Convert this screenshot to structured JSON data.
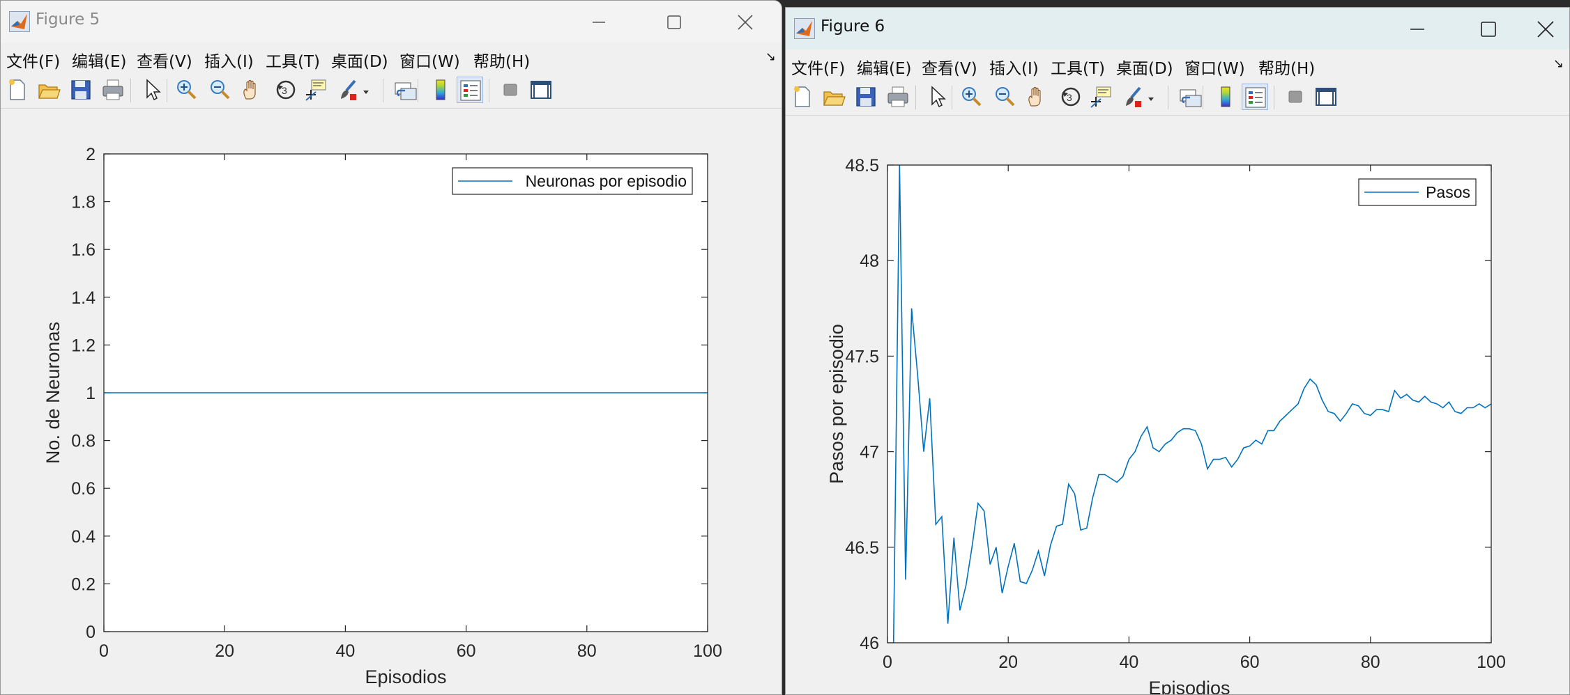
{
  "menu_labels": [
    "文件(F)",
    "编辑(E)",
    "查看(V)",
    "插入(I)",
    "工具(T)",
    "桌面(D)",
    "窗口(W)",
    "帮助(H)"
  ],
  "toolbar_buttons": [
    {
      "name": "new-figure-icon"
    },
    {
      "name": "open-file-icon"
    },
    {
      "name": "save-icon"
    },
    {
      "name": "print-icon"
    },
    {
      "name": "edit-plot-arrow-icon"
    },
    {
      "name": "zoom-in-icon"
    },
    {
      "name": "zoom-out-icon"
    },
    {
      "name": "pan-hand-icon"
    },
    {
      "name": "rotate-3d-icon"
    },
    {
      "name": "data-cursor-icon"
    },
    {
      "name": "brush-icon"
    },
    {
      "name": "link-plot-icon"
    },
    {
      "name": "colorbar-icon"
    },
    {
      "name": "legend-icon"
    },
    {
      "name": "hide-plot-tools-icon"
    },
    {
      "name": "show-plot-tools-icon"
    }
  ],
  "windows": [
    {
      "id": "win5",
      "title": "Figure 5",
      "chart_data": {
        "type": "line",
        "xlabel": "Episodios",
        "ylabel": "No. de Neuronas",
        "xlim": [
          0,
          100
        ],
        "ylim": [
          0,
          2
        ],
        "xticks": [
          "0",
          "20",
          "40",
          "60",
          "80",
          "100"
        ],
        "yticks": [
          "0",
          "0.2",
          "0.4",
          "0.6",
          "0.8",
          "1",
          "1.2",
          "1.4",
          "1.6",
          "1.8",
          "2"
        ],
        "legend_position": "top-right",
        "series": [
          {
            "name": "Neuronas por episodio",
            "color": "#0072bd",
            "x": [
              0,
              100
            ],
            "y": [
              1,
              1
            ]
          }
        ]
      }
    },
    {
      "id": "win6",
      "title": "Figure 6",
      "chart_data": {
        "type": "line",
        "xlabel": "Episodios",
        "ylabel": "Pasos por episodio",
        "xlim": [
          0,
          100
        ],
        "ylim": [
          46,
          48.5
        ],
        "xticks": [
          "0",
          "20",
          "40",
          "60",
          "80",
          "100"
        ],
        "yticks": [
          "46",
          "46.5",
          "47",
          "47.5",
          "48",
          "48.5"
        ],
        "legend_position": "top-right",
        "series": [
          {
            "name": "Pasos",
            "color": "#0072bd",
            "x": [
              1,
              2,
              3,
              4,
              5,
              6,
              7,
              8,
              9,
              10,
              11,
              12,
              13,
              14,
              15,
              16,
              17,
              18,
              19,
              20,
              21,
              22,
              23,
              24,
              25,
              26,
              27,
              28,
              29,
              30,
              31,
              32,
              33,
              34,
              35,
              36,
              37,
              38,
              39,
              40,
              41,
              42,
              43,
              44,
              45,
              46,
              47,
              48,
              49,
              50,
              51,
              52,
              53,
              54,
              55,
              56,
              57,
              58,
              59,
              60,
              61,
              62,
              63,
              64,
              65,
              66,
              67,
              68,
              69,
              70,
              71,
              72,
              73,
              74,
              75,
              76,
              77,
              78,
              79,
              80,
              81,
              82,
              83,
              84,
              85,
              86,
              87,
              88,
              89,
              90,
              91,
              92,
              93,
              94,
              95,
              96,
              97,
              98,
              99,
              100
            ],
            "y": [
              46.0,
              48.5,
              46.33,
              47.75,
              47.4,
              47.0,
              47.28,
              46.62,
              46.66,
              46.1,
              46.55,
              46.17,
              46.3,
              46.5,
              46.73,
              46.69,
              46.41,
              46.5,
              46.26,
              46.4,
              46.52,
              46.32,
              46.31,
              46.38,
              46.48,
              46.35,
              46.51,
              46.61,
              46.62,
              46.83,
              46.78,
              46.59,
              46.6,
              46.76,
              46.88,
              46.88,
              46.86,
              46.84,
              46.87,
              46.96,
              47.0,
              47.08,
              47.13,
              47.02,
              47.0,
              47.04,
              47.06,
              47.1,
              47.12,
              47.12,
              47.11,
              47.04,
              46.91,
              46.96,
              46.96,
              46.97,
              46.92,
              46.96,
              47.02,
              47.03,
              47.06,
              47.04,
              47.11,
              47.11,
              47.16,
              47.19,
              47.22,
              47.25,
              47.33,
              47.38,
              47.35,
              47.27,
              47.21,
              47.2,
              47.16,
              47.2,
              47.25,
              47.24,
              47.2,
              47.19,
              47.22,
              47.22,
              47.21,
              47.32,
              47.28,
              47.3,
              47.27,
              47.26,
              47.29,
              47.26,
              47.25,
              47.23,
              47.26,
              47.21,
              47.2,
              47.23,
              47.23,
              47.25,
              47.23,
              47.25
            ]
          }
        ]
      }
    }
  ]
}
